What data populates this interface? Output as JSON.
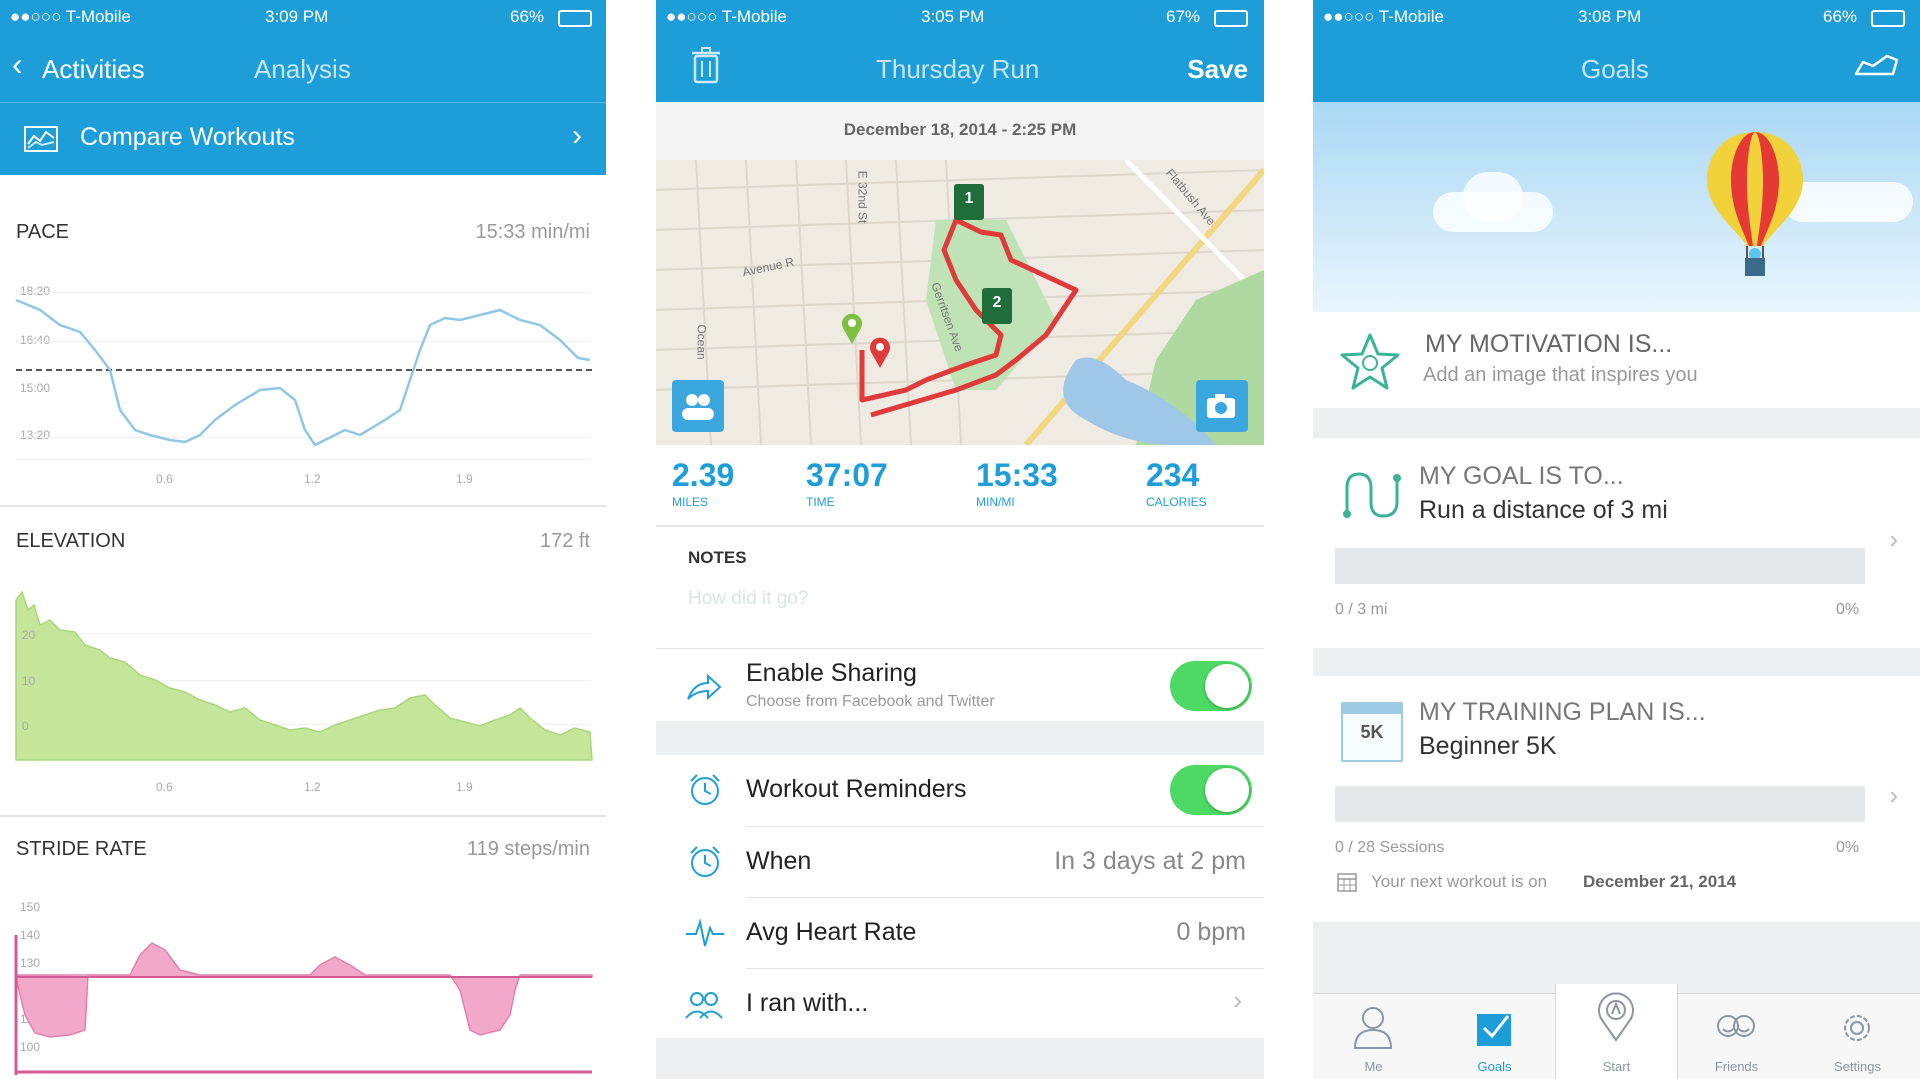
{
  "screen1": {
    "status": {
      "carrier": "●●○○○ T-Mobile",
      "time": "3:09 PM",
      "battery": "66%"
    },
    "nav": {
      "back_label": "Activities",
      "title": "Analysis"
    },
    "compare_label": "Compare Workouts",
    "pace": {
      "label": "PACE",
      "value": "15:33 min/mi",
      "yticks": [
        "18:20",
        "16:40",
        "15:00",
        "13:20"
      ],
      "xticks": [
        "0.6",
        "1.2",
        "1.9"
      ]
    },
    "elevation": {
      "label": "ELEVATION",
      "value": "172 ft",
      "yticks": [
        "20",
        "10",
        "0"
      ],
      "xticks": [
        "0.6",
        "1.2",
        "1.9"
      ]
    },
    "stride": {
      "label": "STRIDE RATE",
      "value": "119 steps/min",
      "yticks": [
        "150",
        "140",
        "130",
        "120",
        "110",
        "100"
      ]
    }
  },
  "screen2": {
    "status": {
      "carrier": "●●○○○ T-Mobile",
      "time": "3:05 PM",
      "battery": "67%"
    },
    "nav": {
      "title": "Thursday Run",
      "save_label": "Save"
    },
    "date": "December 18, 2014 - 2:25 PM",
    "map_labels": [
      "Avenue R",
      "Gerritsen Ave",
      "Flatbush Ave",
      "Ocean",
      "E 32nd St"
    ],
    "markers": [
      "1",
      "2"
    ],
    "stats": [
      {
        "value": "2.39",
        "label": "MILES"
      },
      {
        "value": "37:07",
        "label": "TIME"
      },
      {
        "value": "15:33",
        "label": "MIN/MI"
      },
      {
        "value": "234",
        "label": "CALORIES"
      }
    ],
    "notes_label": "NOTES",
    "notes_placeholder": "How did it go?",
    "sharing": {
      "title": "Enable Sharing",
      "subtitle": "Choose from Facebook and Twitter"
    },
    "reminders_label": "Workout Reminders",
    "when": {
      "label": "When",
      "value": "In 3 days at 2 pm"
    },
    "heart": {
      "label": "Avg Heart Rate",
      "value": "0 bpm"
    },
    "ranwith_label": "I ran with..."
  },
  "screen3": {
    "status": {
      "carrier": "●●○○○ T-Mobile",
      "time": "3:08 PM",
      "battery": "66%"
    },
    "nav": {
      "title": "Goals"
    },
    "motivation": {
      "title": "MY MOTIVATION IS...",
      "subtitle": "Add an image that inspires you"
    },
    "goal": {
      "title": "MY GOAL IS TO...",
      "value": "Run a distance of 3 mi",
      "progress_text": "0 / 3 mi",
      "percent": "0%",
      "progress": 0
    },
    "plan": {
      "title": "MY TRAINING PLAN IS...",
      "value": "Beginner 5K",
      "badge": "5K",
      "progress_text": "0 / 28 Sessions",
      "percent": "0%",
      "progress": 0,
      "next_prefix": "Your next workout is on",
      "next_date": "December 21, 2014"
    },
    "tabs": [
      {
        "label": "Me",
        "icon": "person-icon"
      },
      {
        "label": "Goals",
        "icon": "goals-check-icon"
      },
      {
        "label": "Start",
        "icon": "start-pin-icon"
      },
      {
        "label": "Friends",
        "icon": "friends-icon"
      },
      {
        "label": "Settings",
        "icon": "gear-icon"
      }
    ]
  },
  "colors": {
    "brand": "#1e9ed9",
    "toggle_on": "#4cd964",
    "route": "#e03a3a",
    "elevation_fill": "#c4e59a",
    "stride_fill": "#f2a9c9"
  }
}
